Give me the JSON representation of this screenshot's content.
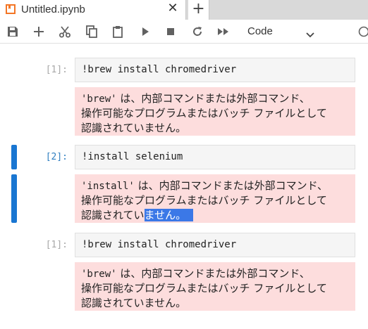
{
  "tab": {
    "title": "Untitled.ipynb",
    "close_glyph": "✕",
    "new_tab_glyph": "+",
    "icon": "notebook-icon",
    "icon_color": "#f37626"
  },
  "toolbar": {
    "buttons": [
      "save-icon",
      "add-cell-icon",
      "cut-icon",
      "copy-icon",
      "paste-icon",
      "run-icon",
      "stop-icon",
      "restart-icon",
      "fast-forward-icon"
    ],
    "cell_type": "Code"
  },
  "cells": [
    {
      "prompt": "[1]:",
      "code": "!brew install chromedriver",
      "output": {
        "line1_mono": "'brew'",
        "line1_rest": " は、内部コマンドまたは外部コマンド、",
        "line2": "操作可能なプログラムまたはバッチ ファイルとして",
        "line3": "認識されていません。"
      }
    },
    {
      "prompt": "[2]:",
      "code": "!install selenium",
      "output": {
        "line1_mono": "'install'",
        "line1_rest": " は、内部コマンドまたは外部コマンド、",
        "line2": "操作可能なプログラムまたはバッチ ファイルとして",
        "line3_plain": "認識されてい",
        "line3_selected": "ません。"
      }
    },
    {
      "prompt": "[1]:",
      "code": "!brew install chromedriver",
      "output": {
        "line1_mono": "'brew'",
        "line1_rest": " は、内部コマンドまたは外部コマンド、",
        "line2": "操作可能なプログラムまたはバッチ ファイルとして",
        "line3": "認識されていません。"
      }
    }
  ],
  "colors": {
    "active_collapser": "#1976d2",
    "error_output_bg": "#fddddd",
    "selection": "#3b78e7"
  }
}
